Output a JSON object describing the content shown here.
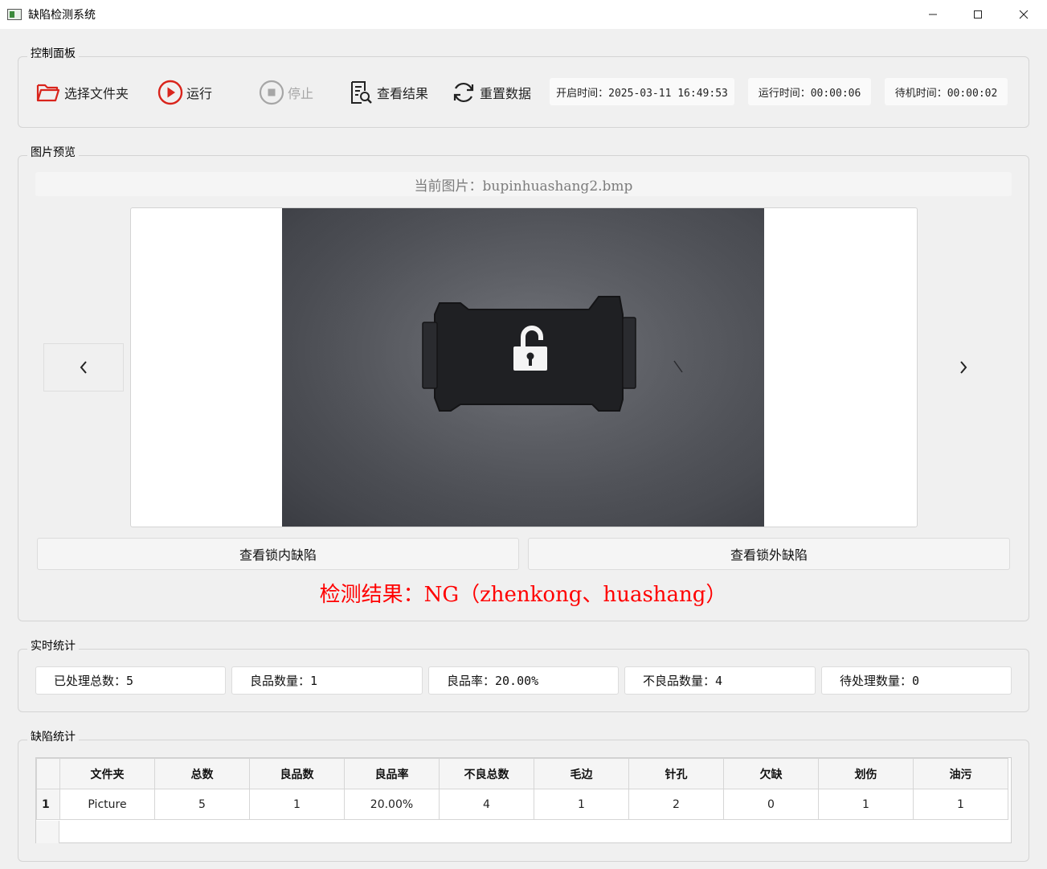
{
  "window": {
    "title": "缺陷检测系统"
  },
  "control_panel": {
    "title": "控制面板",
    "buttons": {
      "select_folder": "选择文件夹",
      "run": "运行",
      "stop": "停止",
      "view_results": "查看结果",
      "reset_data": "重置数据"
    },
    "start_time": "开启时间：2025-03-11 16:49:53",
    "run_time": "运行时间：00:00:06",
    "idle_time": "待机时间：00:00:02"
  },
  "preview": {
    "title": "图片预览",
    "current_image": "当前图片：bupinhuashang2.bmp",
    "view_inner_defects": "查看锁内缺陷",
    "view_outer_defects": "查看锁外缺陷",
    "result_text": "检测结果：NG（zhenkong、huashang）"
  },
  "realtime_stats": {
    "title": "实时统计",
    "processed_total": "已处理总数：5",
    "good_count": "良品数量：1",
    "good_rate": "良品率：20.00%",
    "bad_count": "不良品数量：4",
    "pending_count": "待处理数量：0"
  },
  "defect_stats": {
    "title": "缺陷统计",
    "columns": [
      "文件夹",
      "总数",
      "良品数",
      "良品率",
      "不良总数",
      "毛边",
      "针孔",
      "欠缺",
      "划伤",
      "油污"
    ],
    "rows": [
      {
        "index": "1",
        "cells": [
          "Picture",
          "5",
          "1",
          "20.00%",
          "4",
          "1",
          "2",
          "0",
          "1",
          "1"
        ]
      }
    ]
  },
  "colors": {
    "accent_red": "#d9241c",
    "result_red": "#ff0000",
    "disabled_gray": "#a6a6a6"
  },
  "icons": [
    "folder-open-icon",
    "play-circle-icon",
    "stop-circle-icon",
    "document-search-icon",
    "refresh-icon",
    "chevron-left-icon",
    "chevron-right-icon",
    "unlock-icon"
  ]
}
